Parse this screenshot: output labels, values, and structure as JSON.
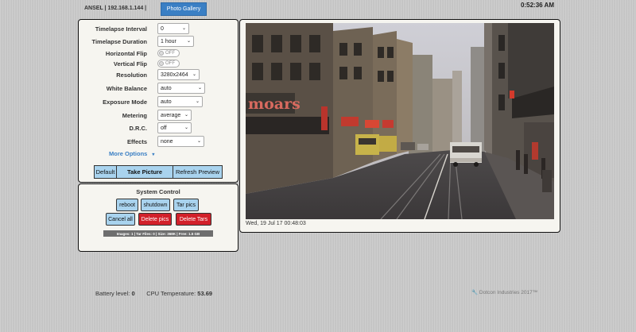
{
  "header": {
    "host": "ANSEL | 192.168.1.144 |",
    "gallery_button": "Photo Gallery",
    "time": "0:52:36 AM"
  },
  "settings": {
    "timelapse_interval": {
      "label": "Timelapse Interval",
      "value": "0"
    },
    "timelapse_duration": {
      "label": "Timelapse Duration",
      "value": "1 hour"
    },
    "horizontal_flip": {
      "label": "Horizontal Flip",
      "value": "OFF"
    },
    "vertical_flip": {
      "label": "Vertical Flip",
      "value": "OFF"
    },
    "resolution": {
      "label": "Resolution",
      "value": "3280x2464"
    },
    "white_balance": {
      "label": "White Balance",
      "value": "auto"
    },
    "exposure_mode": {
      "label": "Exposure Mode",
      "value": "auto"
    },
    "metering": {
      "label": "Metering",
      "value": "average"
    },
    "drc": {
      "label": "D.R.C.",
      "value": "off"
    },
    "effects": {
      "label": "Effects",
      "value": "none"
    },
    "more_options": "More Options"
  },
  "actions": {
    "default": "Default",
    "take_picture": "Take Picture",
    "refresh_preview": "Refresh Preview"
  },
  "system": {
    "title": "System Control",
    "reboot": "reboot",
    "shutdown": "shutdown",
    "tar_pics": "Tar pics",
    "cancel_all": "Cancel all",
    "delete_pics": "Delete pics",
    "delete_tars": "Delete Tars",
    "status": "Images: 1  |  Tar Files: 0  |  Size: 368K  |  Free: 1.5 GB"
  },
  "preview": {
    "caption": "Wed, 19 Jul 17 00:48:03"
  },
  "footer": {
    "battery_label": "Battery level:",
    "battery_value": "0",
    "cpu_label": "CPU Temperature:",
    "cpu_value": "53.69",
    "credit": "Dotcon Industries 2017™"
  },
  "colors": {
    "accent_blue": "#3a7fc4",
    "button_blue": "#a9d3ee",
    "danger_red": "#d2212a",
    "panel_bg": "#f6f5f0"
  }
}
